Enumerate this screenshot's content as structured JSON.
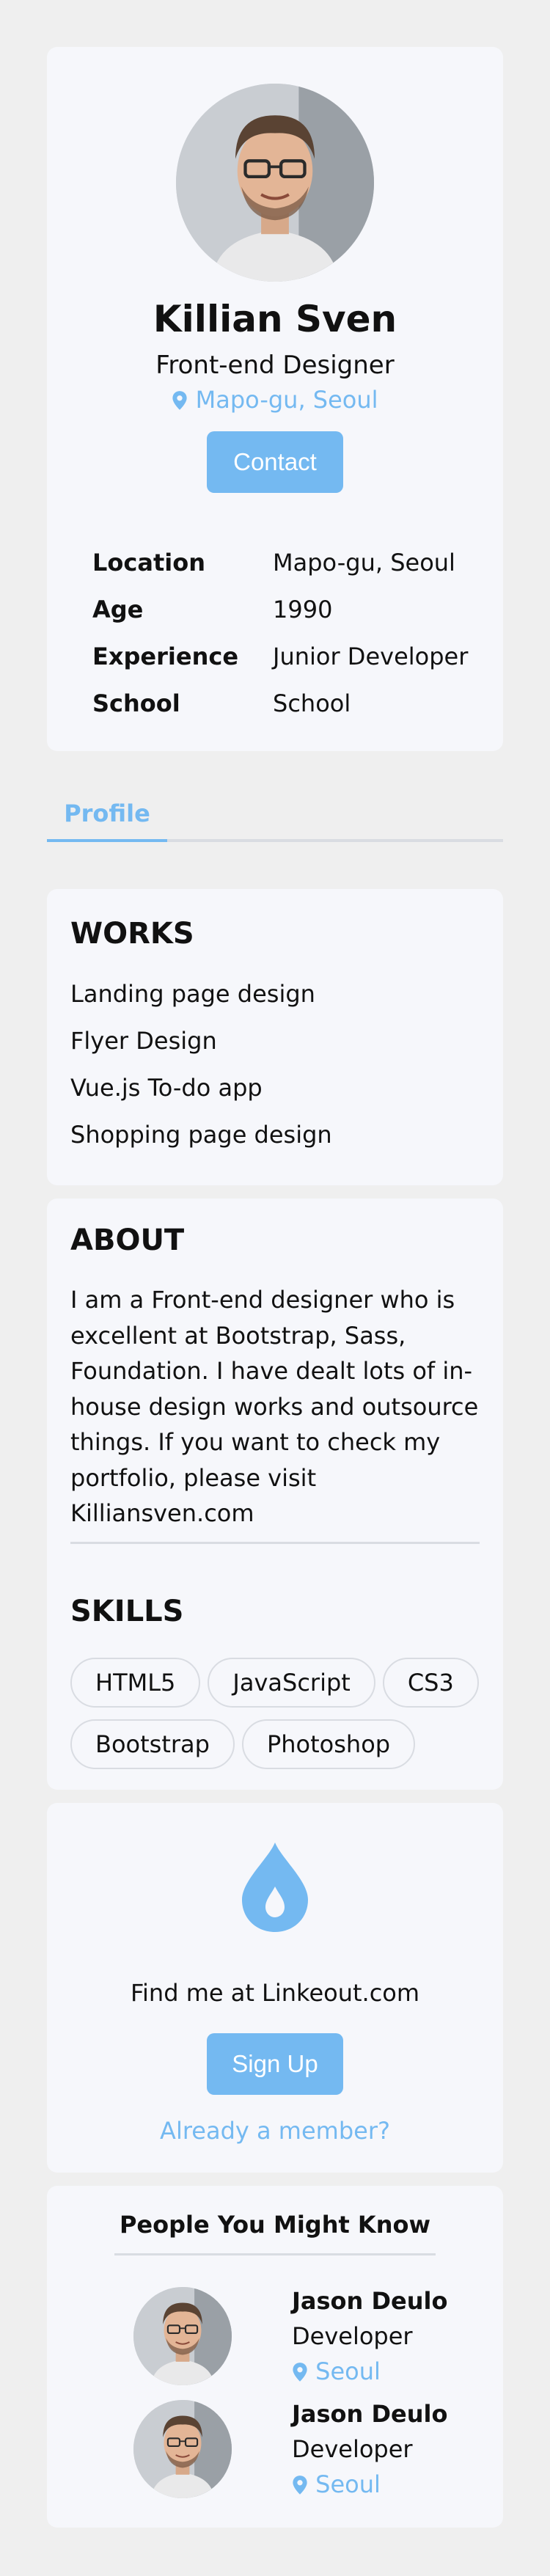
{
  "profile": {
    "name": "Killian Sven",
    "title": "Front-end Designer",
    "location": "Mapo-gu, Seoul",
    "contact_label": "Contact",
    "info": [
      {
        "key": "Location",
        "value": "Mapo-gu, Seoul"
      },
      {
        "key": "Age",
        "value": "1990"
      },
      {
        "key": "Experience",
        "value": "Junior Developer"
      },
      {
        "key": "School",
        "value": "School"
      }
    ]
  },
  "tabs": [
    {
      "label": "Profile",
      "active": true
    }
  ],
  "works": {
    "heading": "WORKS",
    "items": [
      "Landing page design",
      "Flyer Design",
      "Vue.js To-do app",
      "Shopping page design"
    ]
  },
  "about": {
    "heading": "ABOUT",
    "text": "I am a Front-end designer who is excellent at Bootstrap, Sass, Foundation. I have dealt lots of in-house design works and outsource things. If you want to check my portfolio, please visit Killiansven.com"
  },
  "skills": {
    "heading": "SKILLS",
    "items": [
      "HTML5",
      "JavaScript",
      "CS3",
      "Bootstrap",
      "Photoshop"
    ]
  },
  "linkeout": {
    "icon": "drop-icon",
    "text": "Find me at Linkeout.com",
    "signup_label": "Sign Up",
    "member_link": "Already a member?"
  },
  "people": {
    "heading": "People You Might Know",
    "items": [
      {
        "name": "Jason Deulo",
        "role": "Developer",
        "location": "Seoul"
      },
      {
        "name": "Jason Deulo",
        "role": "Developer",
        "location": "Seoul"
      }
    ]
  },
  "colors": {
    "accent": "#74b9f1",
    "card": "#f6f7fb",
    "background": "#efefef",
    "divider": "#d9dce2"
  }
}
